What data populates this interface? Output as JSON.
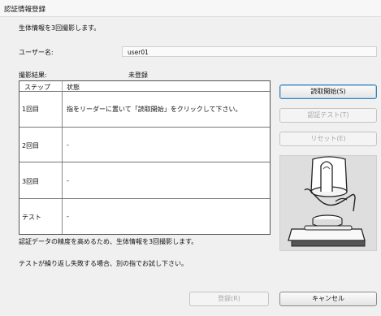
{
  "window": {
    "title": "認証情報登録"
  },
  "instruction": "生体情報を3回撮影します。",
  "username": {
    "label": "ユーザー名:",
    "value": "user01"
  },
  "capture": {
    "label": "撮影結果:",
    "status": "未登録"
  },
  "table": {
    "headers": [
      "ステップ",
      "状態"
    ],
    "rows": [
      {
        "step": "1回目",
        "status": "指をリーダーに置いて「読取開始」をクリックして下さい。"
      },
      {
        "step": "2回目",
        "status": "-"
      },
      {
        "step": "3回目",
        "status": "-"
      },
      {
        "step": "テスト",
        "status": "-"
      }
    ]
  },
  "notes": {
    "line1": "認証データの精度を高めるため、生体情報を3回撮影します。",
    "line2": "テストが繰り返し失敗する場合、別の指でお試し下さい。"
  },
  "buttons": {
    "start": "読取開始(S)",
    "test": "認証テスト(T)",
    "reset": "リセット(E)",
    "register": "登録(R)",
    "cancel": "キャンセル"
  },
  "colors": {
    "accent": "#3c7fb1",
    "disabled_text": "#a8a8a8"
  }
}
